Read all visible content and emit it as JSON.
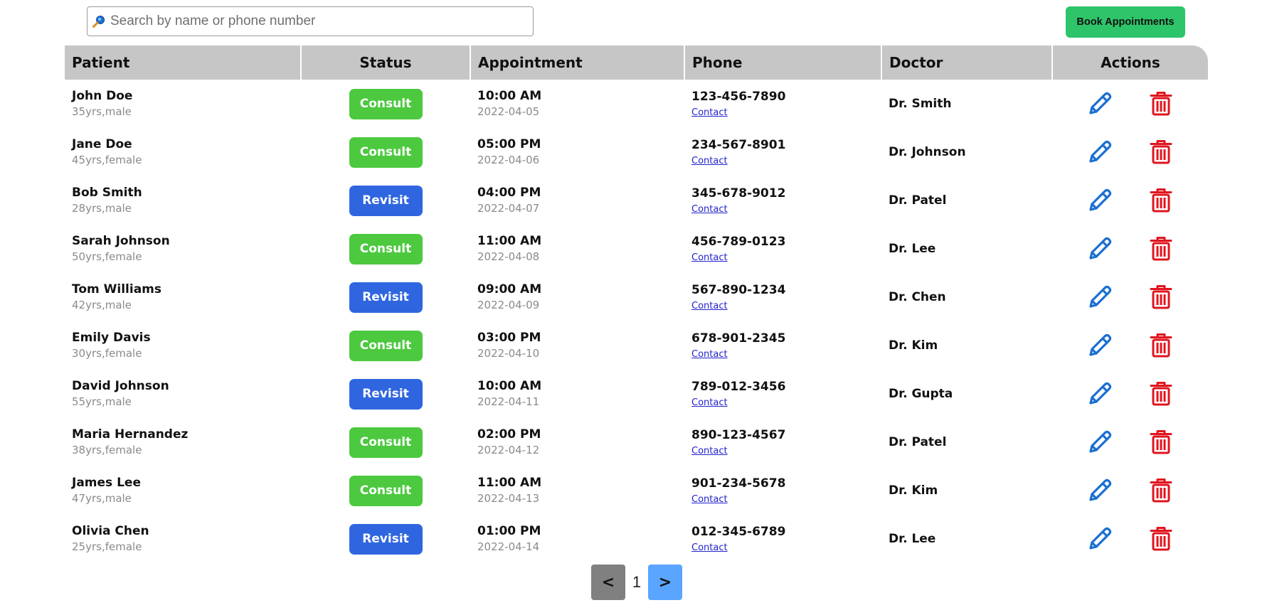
{
  "search": {
    "placeholder": "Search by name or phone number",
    "value": ""
  },
  "toolbar": {
    "book_label": "Book Appointments"
  },
  "table": {
    "headers": [
      "Patient",
      "Status",
      "Appointment",
      "Phone",
      "Doctor",
      "Actions"
    ],
    "rows": [
      {
        "name": "John Doe",
        "meta": "35yrs,male",
        "status": "Consult",
        "time": "10:00 AM",
        "date": "2022-04-05",
        "phone": "123-456-7890",
        "contact": "Contact",
        "doctor": "Dr. Smith"
      },
      {
        "name": "Jane Doe",
        "meta": "45yrs,female",
        "status": "Consult",
        "time": "05:00 PM",
        "date": "2022-04-06",
        "phone": "234-567-8901",
        "contact": "Contact",
        "doctor": "Dr. Johnson"
      },
      {
        "name": "Bob Smith",
        "meta": "28yrs,male",
        "status": "Revisit",
        "time": "04:00 PM",
        "date": "2022-04-07",
        "phone": "345-678-9012",
        "contact": "Contact",
        "doctor": "Dr. Patel"
      },
      {
        "name": "Sarah Johnson",
        "meta": "50yrs,female",
        "status": "Consult",
        "time": "11:00 AM",
        "date": "2022-04-08",
        "phone": "456-789-0123",
        "contact": "Contact",
        "doctor": "Dr. Lee"
      },
      {
        "name": "Tom Williams",
        "meta": "42yrs,male",
        "status": "Revisit",
        "time": "09:00 AM",
        "date": "2022-04-09",
        "phone": "567-890-1234",
        "contact": "Contact",
        "doctor": "Dr. Chen"
      },
      {
        "name": "Emily Davis",
        "meta": "30yrs,female",
        "status": "Consult",
        "time": "03:00 PM",
        "date": "2022-04-10",
        "phone": "678-901-2345",
        "contact": "Contact",
        "doctor": "Dr. Kim"
      },
      {
        "name": "David Johnson",
        "meta": "55yrs,male",
        "status": "Revisit",
        "time": "10:00 AM",
        "date": "2022-04-11",
        "phone": "789-012-3456",
        "contact": "Contact",
        "doctor": "Dr. Gupta"
      },
      {
        "name": "Maria Hernandez",
        "meta": "38yrs,female",
        "status": "Consult",
        "time": "02:00 PM",
        "date": "2022-04-12",
        "phone": "890-123-4567",
        "contact": "Contact",
        "doctor": "Dr. Patel"
      },
      {
        "name": "James Lee",
        "meta": "47yrs,male",
        "status": "Consult",
        "time": "11:00 AM",
        "date": "2022-04-13",
        "phone": "901-234-5678",
        "contact": "Contact",
        "doctor": "Dr. Kim"
      },
      {
        "name": "Olivia Chen",
        "meta": "25yrs,female",
        "status": "Revisit",
        "time": "01:00 PM",
        "date": "2022-04-14",
        "phone": "012-345-6789",
        "contact": "Contact",
        "doctor": "Dr. Lee"
      }
    ]
  },
  "pagination": {
    "prev_label": "<",
    "current_page": "1",
    "next_label": ">"
  },
  "colors": {
    "consult": "#4cc93f",
    "revisit": "#2f66e0",
    "book_button": "#2ec56a",
    "header_bg": "#c6c6c6",
    "edit_icon": "#1a6fd1",
    "delete_icon": "#e0141e"
  },
  "icons": {
    "search": "magnifier-icon",
    "edit": "pencil-icon",
    "delete": "trash-icon"
  }
}
